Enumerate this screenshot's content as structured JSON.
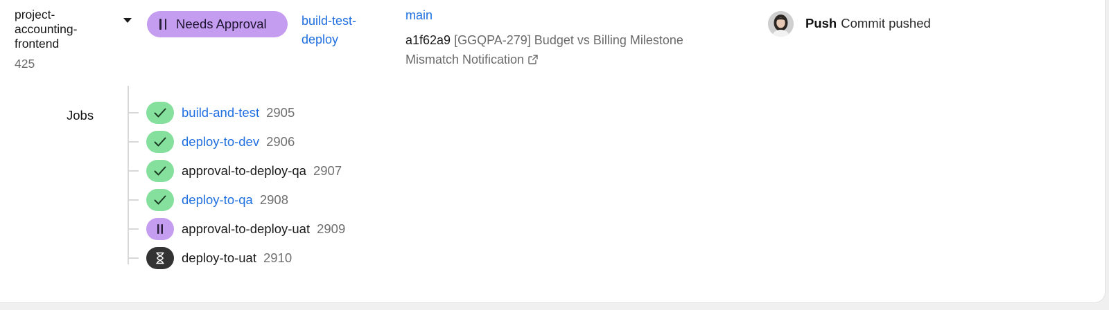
{
  "pipeline": {
    "project_name": "project-accounting-frontend",
    "project_number": "425",
    "status_label": "Needs Approval",
    "workflow_name": "build-test-deploy",
    "branch": "main",
    "commit_sha": "a1f62a9",
    "commit_message": "[GGQPA-279] Budget vs Billing Milestone Mismatch Notification",
    "trigger_type": "Push",
    "trigger_text": "Commit pushed"
  },
  "jobs_label": "Jobs",
  "jobs": [
    {
      "name": "build-and-test",
      "number": "2905",
      "status": "success",
      "link": true
    },
    {
      "name": "deploy-to-dev",
      "number": "2906",
      "status": "success",
      "link": true
    },
    {
      "name": "approval-to-deploy-qa",
      "number": "2907",
      "status": "success",
      "link": false
    },
    {
      "name": "deploy-to-qa",
      "number": "2908",
      "status": "success",
      "link": true
    },
    {
      "name": "approval-to-deploy-uat",
      "number": "2909",
      "status": "on-hold",
      "link": false
    },
    {
      "name": "deploy-to-uat",
      "number": "2910",
      "status": "queued",
      "link": false
    }
  ],
  "colors": {
    "success": "#86e09d",
    "on_hold": "#c49cf0",
    "queued": "#333333",
    "link": "#1f6fe0"
  }
}
